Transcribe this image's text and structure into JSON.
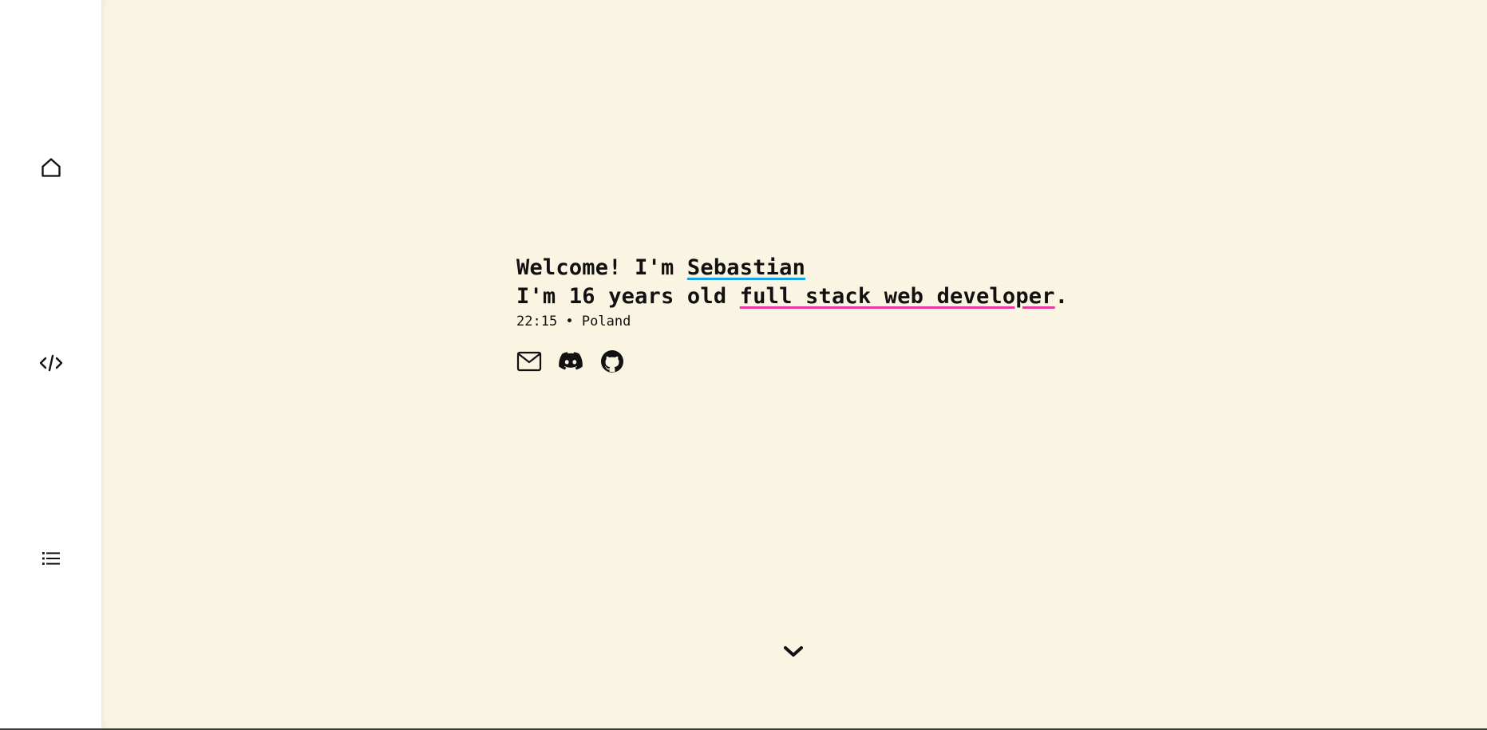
{
  "sidebar": {
    "items": [
      {
        "icon": "home-icon"
      },
      {
        "icon": "code-icon"
      },
      {
        "icon": "list-icon"
      }
    ]
  },
  "hero": {
    "line1_prefix": "Welcome! I'm ",
    "name": "Sebastian",
    "line2_prefix": "I'm 16 years old ",
    "role": "full stack web developer",
    "line2_suffix": ".",
    "time": "22:15",
    "separator": " • ",
    "location": "Poland"
  },
  "socials": [
    {
      "icon": "mail-icon"
    },
    {
      "icon": "discord-icon"
    },
    {
      "icon": "github-icon"
    }
  ],
  "scroll": {
    "icon": "chevron-down-icon"
  },
  "colors": {
    "background": "#faf4e2",
    "sidebar": "#ffffff",
    "name_underline": "#1aa3e0",
    "role_underline": "#e63b9a",
    "text": "#111111"
  }
}
